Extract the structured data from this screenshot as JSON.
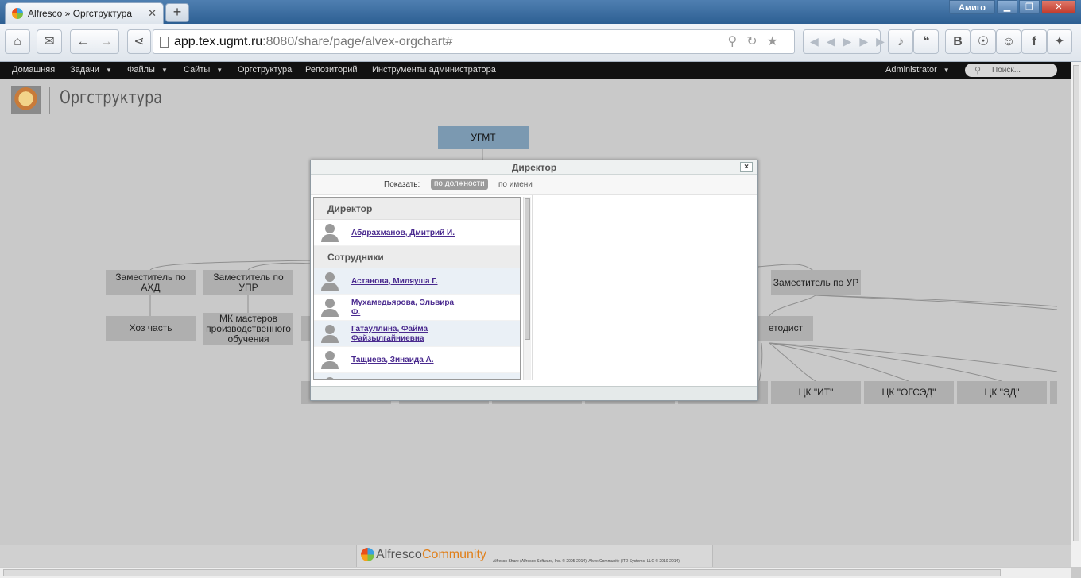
{
  "browser": {
    "tab_title": "Alfresco » Оргструктура",
    "amigo_label": "Амиго",
    "url_host": "app.tex.ugmt.ru",
    "url_rest": ":8080/share/page/alvex-orgchart#"
  },
  "nav": {
    "items": [
      "Домашняя",
      "Задачи",
      "Файлы",
      "Сайты",
      "Оргструктура",
      "Репозиторий",
      "Инструменты администратора"
    ],
    "user": "Administrator",
    "search_placeholder": "Поиск..."
  },
  "page": {
    "title": "Оргструктура"
  },
  "org": {
    "root": "УГМТ",
    "deputies": [
      "Заместитель по АХД",
      "Заместитель по УПР",
      "Заместитель по УР"
    ],
    "units": [
      "Хоз часть",
      "МК мастеров производственного обучения",
      "етодист"
    ],
    "cks": [
      "ЦК \"ИТ\"",
      "ЦК \"ОГСЭД\"",
      "ЦК \"ЭД\""
    ]
  },
  "dialog": {
    "title": "Директор",
    "close": "×",
    "show_label": "Показать:",
    "by_position": "по должности",
    "by_name": "по имени",
    "group_director": "Директор",
    "group_staff": "Сотрудники",
    "director": "Абдрахманов, Дмитрий И.",
    "staff": [
      "Астанова, Миляуша Г.",
      "Мухамедьярова, Эльвира Ф.",
      "Гатауллина, Файма Файзылгайниевна",
      "Тащиева, Зинаида А."
    ]
  },
  "footer": {
    "brand": "Alfresco",
    "edition": "Community",
    "copyright": "Alfresco Share (Alfresco Software, Inc. © 2005-2014), Alvex Community (ITD Systems, LLC © 2010-2014)"
  }
}
